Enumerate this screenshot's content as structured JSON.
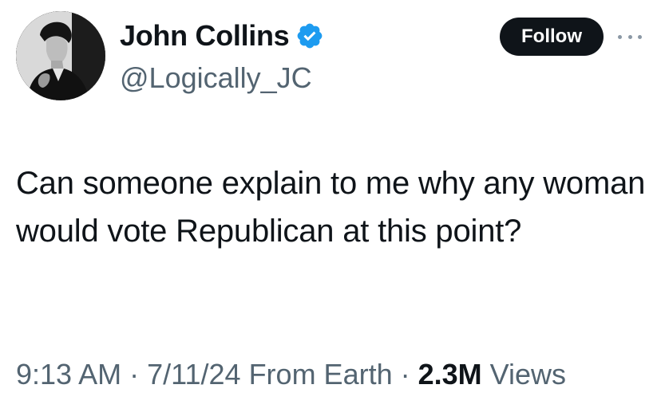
{
  "author": {
    "display_name": "John Collins",
    "handle": "@Logically_JC",
    "verified": true,
    "verified_color": "#1d9bf0"
  },
  "actions": {
    "follow_label": "Follow",
    "more_icon": "more-dots-icon"
  },
  "tweet": {
    "text": "Can someone explain to me why any woman would vote Republican at this point?"
  },
  "meta": {
    "time": "9:13 AM",
    "sep1": " · ",
    "date": "7/11/24",
    "source": "From Earth",
    "sep2": " · ",
    "views_count": "2.3M",
    "views_label": "Views"
  },
  "colors": {
    "text_primary": "#0f1419",
    "text_secondary": "#536471",
    "button_bg": "#0f1419"
  }
}
